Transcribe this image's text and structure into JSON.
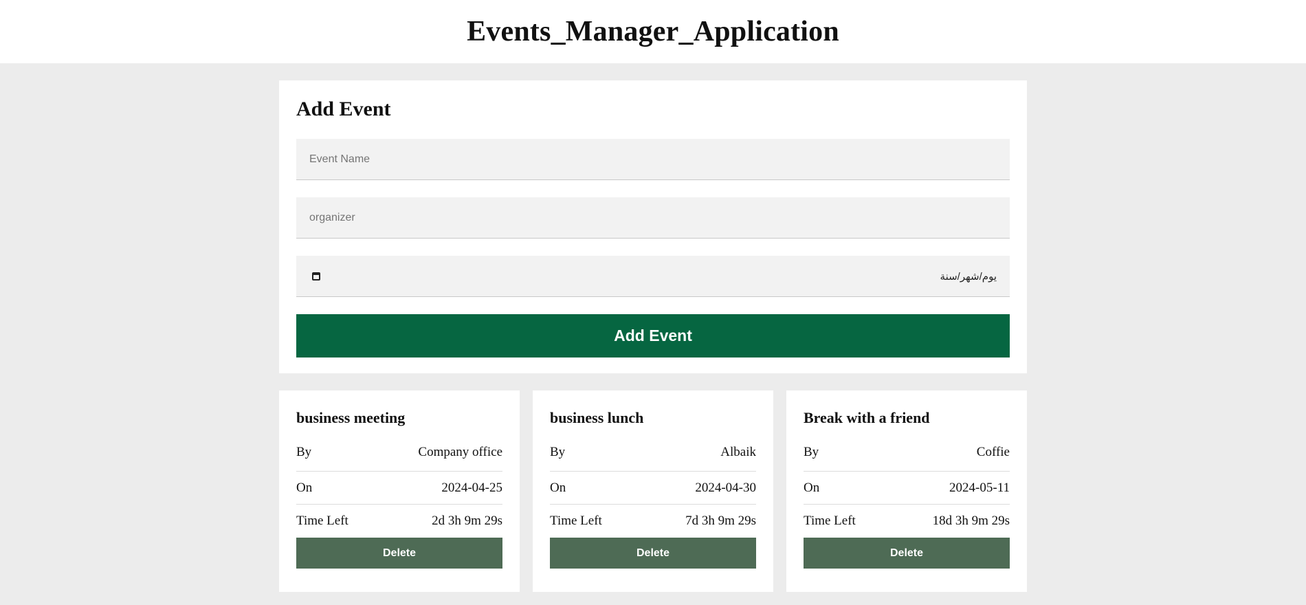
{
  "app": {
    "title": "Events_Manager_Application"
  },
  "form": {
    "title": "Add Event",
    "event_name_placeholder": "Event Name",
    "organizer_placeholder": "organizer",
    "date_placeholder": "يوم/شهر/سنة",
    "date_icon": "calendar-icon",
    "submit_label": "Add Event"
  },
  "events": [
    {
      "name": "business meeting",
      "by_label": "By",
      "by_value": "Company office",
      "on_label": "On",
      "on_value": "2024-04-25",
      "time_left_label": "Time Left",
      "time_left_value": "2d 3h 9m 29s",
      "delete_label": "Delete"
    },
    {
      "name": "business lunch",
      "by_label": "By",
      "by_value": "Albaik",
      "on_label": "On",
      "on_value": "2024-04-30",
      "time_left_label": "Time Left",
      "time_left_value": "7d 3h 9m 29s",
      "delete_label": "Delete"
    },
    {
      "name": "Break with a friend",
      "by_label": "By",
      "by_value": "Coffie",
      "on_label": "On",
      "on_value": "2024-05-11",
      "time_left_label": "Time Left",
      "time_left_value": "18d 3h 9m 29s",
      "delete_label": "Delete"
    }
  ],
  "colors": {
    "page_background": "#ececec",
    "add_button": "#066641",
    "delete_button": "#4e6b55"
  }
}
